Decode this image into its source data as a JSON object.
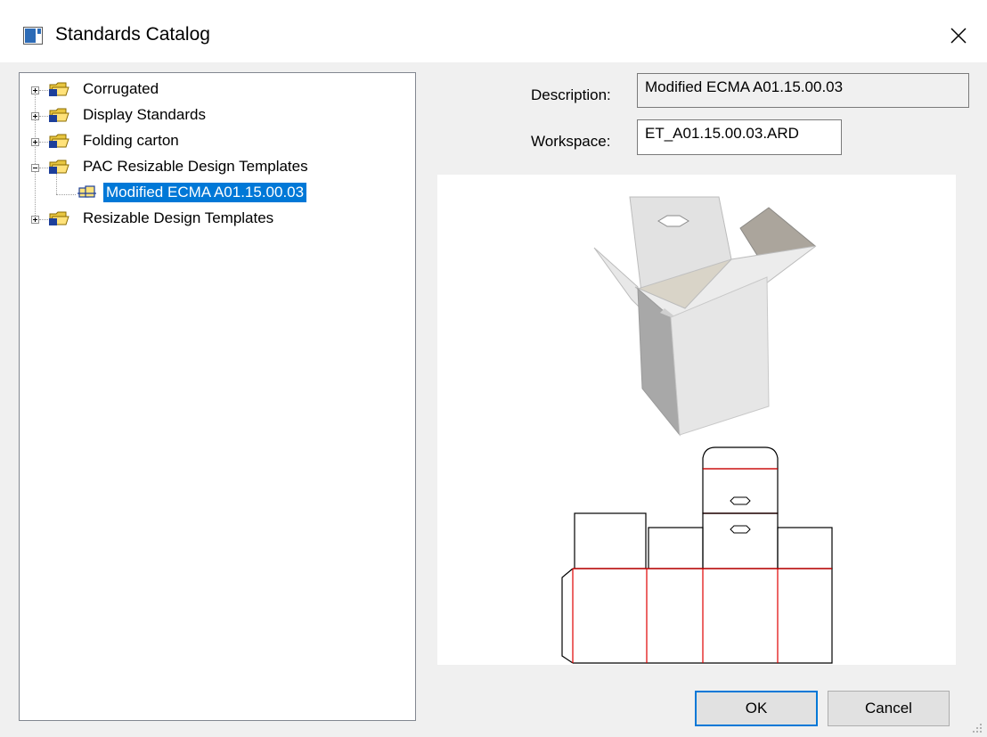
{
  "window": {
    "title": "Standards Catalog",
    "close_glyph": "✕"
  },
  "tree": {
    "items": [
      {
        "label": "Corrugated",
        "state": "collapsed",
        "icon": "folder-icon"
      },
      {
        "label": "Display Standards",
        "state": "collapsed",
        "icon": "folder-icon"
      },
      {
        "label": "Folding carton",
        "state": "collapsed",
        "icon": "folder-icon"
      },
      {
        "label": "PAC Resizable Design Templates",
        "state": "expanded",
        "icon": "folder-icon",
        "children": [
          {
            "label": "Modified ECMA A01.15.00.03",
            "selected": true,
            "icon": "design-icon"
          }
        ]
      },
      {
        "label": "Resizable Design Templates",
        "state": "collapsed",
        "icon": "folder-icon"
      }
    ]
  },
  "details": {
    "description_label": "Description:",
    "description_value": "Modified ECMA A01.15.00.03",
    "workspace_label": "Workspace:",
    "workspace_value": "ET_A01.15.00.03.ARD"
  },
  "buttons": {
    "ok": "OK",
    "cancel": "Cancel"
  },
  "colors": {
    "selection": "#0078d7",
    "crease_line": "#e00000",
    "cut_line": "#000000"
  }
}
